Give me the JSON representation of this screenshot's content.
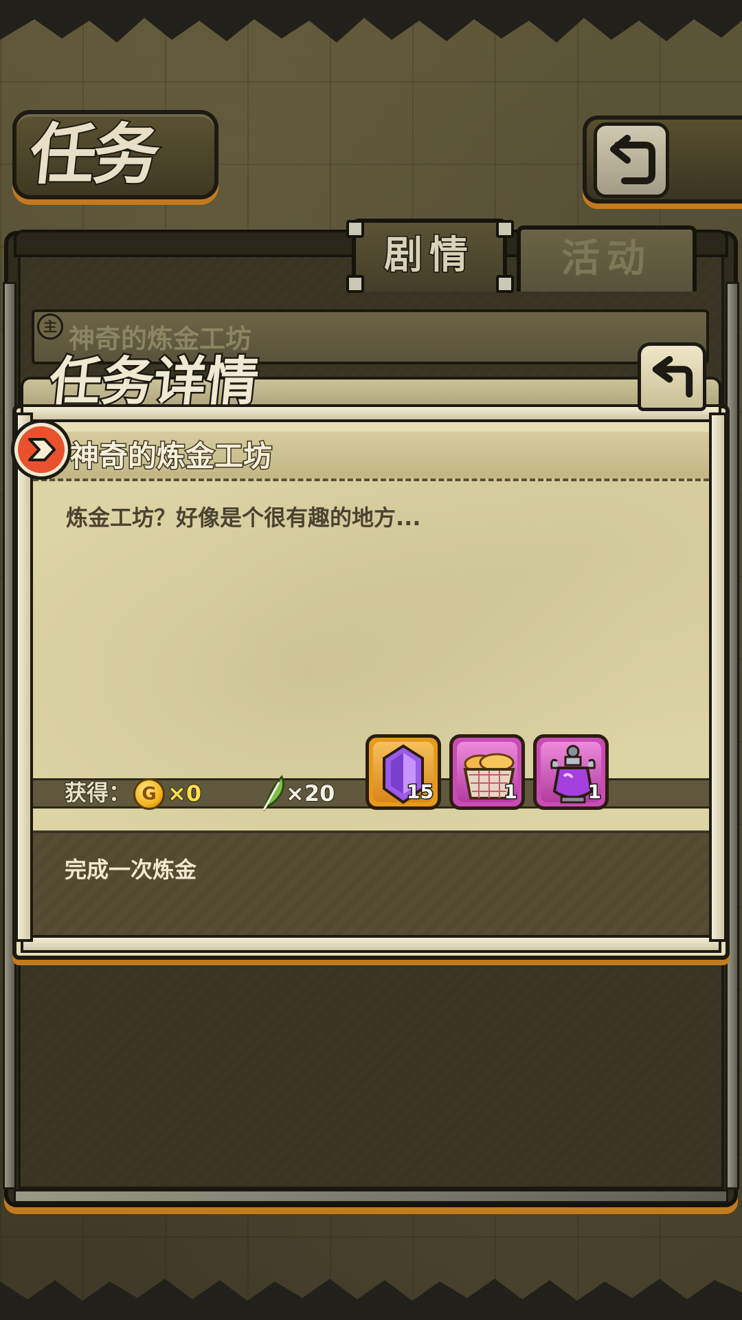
{
  "header": {
    "title": "任务",
    "back_icon": "back-arrow-icon"
  },
  "tabs": [
    {
      "label": "剧情",
      "active": true
    },
    {
      "label": "活动",
      "active": false
    }
  ],
  "quest_list": {
    "badge": "主",
    "title": "神奇的炼金工坊"
  },
  "dialog": {
    "title": "任务详情",
    "close_icon": "back-arrow-icon",
    "quest_name": "神奇的炼金工坊",
    "description": "炼金工坊？好像是个很有趣的地方...",
    "rewards_label": "获得：",
    "coin": {
      "icon": "gold-coin-icon",
      "amount": "×0"
    },
    "feather": {
      "icon": "green-feather-icon",
      "amount": "×20"
    },
    "items": [
      {
        "name": "purple-crystal-icon",
        "quantity": "15",
        "frame": "orange"
      },
      {
        "name": "bread-basket-icon",
        "quantity": "1",
        "frame": "purple"
      },
      {
        "name": "purple-potion-icon",
        "quantity": "1",
        "frame": "purple"
      }
    ],
    "condition": "完成一次炼金"
  },
  "colors": {
    "accent_orange": "#c37a1e",
    "parchment": "#ddd4a6",
    "frame_dark": "#1c1a12",
    "coin_text": "#ffe045"
  }
}
